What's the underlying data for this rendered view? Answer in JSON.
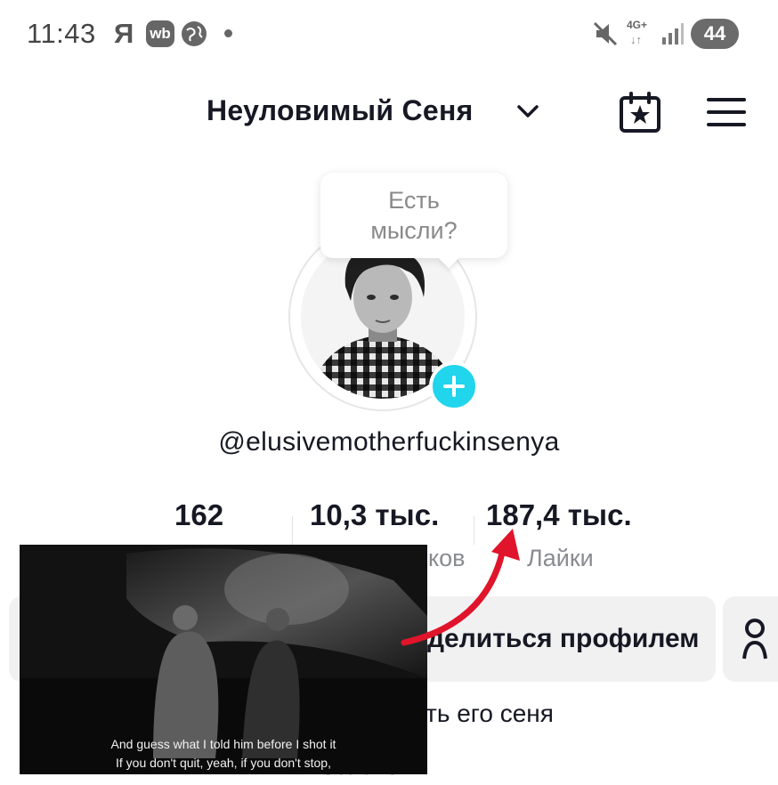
{
  "status_bar": {
    "time": "11:43",
    "ya": "Я",
    "wb": "wb",
    "network": "4G+",
    "battery": "44"
  },
  "header": {
    "title": "Неуловимый Сеня",
    "icons": [
      "chevron-down-icon",
      "calendar-star-icon",
      "menu-icon"
    ]
  },
  "profile": {
    "tooltip": "Есть\nмысли?",
    "username": "@elusivemotherfuckinsenya"
  },
  "stats": [
    {
      "value": "162",
      "label": ""
    },
    {
      "value": "10,3 тыс.",
      "label": "ков"
    },
    {
      "value": "187,4 тыс.",
      "label": "Лайки"
    }
  ],
  "actions": {
    "share_label": "делиться профилем"
  },
  "bio": {
    "text": "ть его сеня",
    "link": "studio"
  },
  "video": {
    "caption_line1": "And guess what I told him before I shot it",
    "caption_line2": "If you don't quit, yeah, if you don't stop,"
  },
  "colors": {
    "accent": "#20d5ec",
    "arrow": "#e0142a",
    "text": "#161823",
    "muted": "#8a8b91"
  }
}
